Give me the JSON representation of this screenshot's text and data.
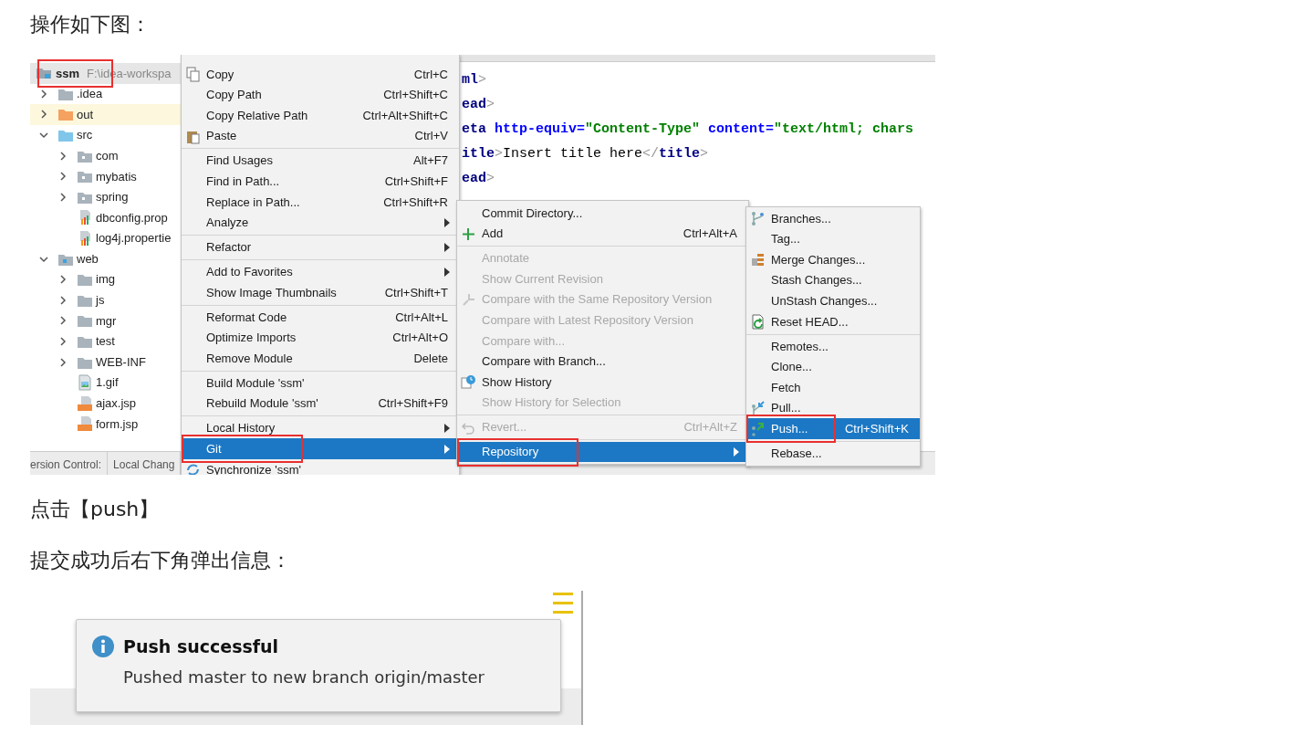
{
  "intro_text": "操作如下图：",
  "ide_screenshot": {
    "project_tree": {
      "root": {
        "label": "ssm",
        "path": "F:\\idea-workspa",
        "annotated": true
      },
      "items": [
        {
          "label": ".idea",
          "kind": "folder",
          "expanded": false
        },
        {
          "label": "out",
          "kind": "output_folder",
          "expanded": false
        },
        {
          "label": "src",
          "kind": "source_folder",
          "expanded": true,
          "children": [
            {
              "label": "com",
              "kind": "package",
              "expanded": false
            },
            {
              "label": "mybatis",
              "kind": "package",
              "expanded": false
            },
            {
              "label": "spring",
              "kind": "package",
              "expanded": false
            },
            {
              "label": "dbconfig.prop",
              "kind": "properties_file"
            },
            {
              "label": "log4j.propertie",
              "kind": "properties_file"
            }
          ]
        },
        {
          "label": "web",
          "kind": "web_folder",
          "expanded": true,
          "children": [
            {
              "label": "img",
              "kind": "folder",
              "expanded": false
            },
            {
              "label": "js",
              "kind": "folder",
              "expanded": false
            },
            {
              "label": "mgr",
              "kind": "folder",
              "expanded": false
            },
            {
              "label": "test",
              "kind": "folder",
              "expanded": false
            },
            {
              "label": "WEB-INF",
              "kind": "folder",
              "expanded": false
            },
            {
              "label": "1.gif",
              "kind": "image_file"
            },
            {
              "label": "ajax.jsp",
              "kind": "jsp_file"
            },
            {
              "label": "form.jsp",
              "kind": "jsp_file"
            }
          ]
        }
      ]
    },
    "code_lines": [
      [
        {
          "kind": "tag",
          "text": "ml"
        },
        {
          "kind": "bracket",
          "text": ">"
        }
      ],
      [
        {
          "kind": "tag",
          "text": "ead"
        },
        {
          "kind": "bracket",
          "text": ">"
        }
      ],
      [
        {
          "kind": "tag",
          "text": "eta"
        },
        {
          "kind": "attr",
          "text": " http-equiv="
        },
        {
          "kind": "string",
          "text": "\"Content-Type\""
        },
        {
          "kind": "attr",
          "text": " content="
        },
        {
          "kind": "string",
          "text": "\"text/html; chars"
        }
      ],
      [
        {
          "kind": "tag",
          "text": "itle"
        },
        {
          "kind": "bracket",
          "text": ">"
        },
        {
          "kind": "text",
          "text": "Insert title here"
        },
        {
          "kind": "bracket",
          "text": "</"
        },
        {
          "kind": "tag",
          "text": "title"
        },
        {
          "kind": "bracket",
          "text": ">"
        }
      ],
      [
        {
          "kind": "tag",
          "text": "ead"
        },
        {
          "kind": "bracket",
          "text": ">"
        }
      ]
    ],
    "bottom_tabs": [
      "ersion Control:",
      "Local Chang"
    ],
    "menus": [
      {
        "items": [
          {
            "kind": "item",
            "label": "Copy",
            "shortcut": "Ctrl+C",
            "selected": false
          },
          {
            "kind": "item",
            "label": "Copy Path",
            "shortcut": "Ctrl+Shift+C",
            "selected": false
          },
          {
            "kind": "item",
            "label": "Copy Relative Path",
            "shortcut": "Ctrl+Alt+Shift+C",
            "selected": false
          },
          {
            "kind": "item",
            "label": "Paste",
            "shortcut": "Ctrl+V",
            "selected": false
          },
          {
            "kind": "separator"
          },
          {
            "kind": "item",
            "label": "Find Usages",
            "shortcut": "Alt+F7",
            "selected": false
          },
          {
            "kind": "item",
            "label": "Find in Path...",
            "shortcut": "Ctrl+Shift+F",
            "selected": false
          },
          {
            "kind": "item",
            "label": "Replace in Path...",
            "shortcut": "Ctrl+Shift+R",
            "selected": false
          },
          {
            "kind": "item",
            "label": "Analyze",
            "submenu": true,
            "selected": false
          },
          {
            "kind": "separator"
          },
          {
            "kind": "item",
            "label": "Refactor",
            "submenu": true,
            "selected": false
          },
          {
            "kind": "separator"
          },
          {
            "kind": "item",
            "label": "Add to Favorites",
            "submenu": true,
            "selected": false
          },
          {
            "kind": "item",
            "label": "Show Image Thumbnails",
            "shortcut": "Ctrl+Shift+T",
            "selected": false
          },
          {
            "kind": "separator"
          },
          {
            "kind": "item",
            "label": "Reformat Code",
            "shortcut": "Ctrl+Alt+L",
            "selected": false
          },
          {
            "kind": "item",
            "label": "Optimize Imports",
            "shortcut": "Ctrl+Alt+O",
            "selected": false
          },
          {
            "kind": "item",
            "label": "Remove Module",
            "shortcut": "Delete",
            "selected": false
          },
          {
            "kind": "separator"
          },
          {
            "kind": "item",
            "label": "Build Module 'ssm'",
            "selected": false
          },
          {
            "kind": "item",
            "label": "Rebuild Module 'ssm'",
            "shortcut": "Ctrl+Shift+F9",
            "selected": false
          },
          {
            "kind": "separator"
          },
          {
            "kind": "item",
            "label": "Local History",
            "submenu": true,
            "selected": false
          },
          {
            "kind": "item",
            "label": "Git",
            "submenu": true,
            "selected": true,
            "annotated": true
          },
          {
            "kind": "item",
            "label": "Synchronize 'ssm'",
            "selected": false
          }
        ]
      },
      {
        "items": [
          {
            "kind": "item",
            "label": "Commit Directory...",
            "disabled": false,
            "selected": false
          },
          {
            "kind": "item",
            "label": "Add",
            "shortcut": "Ctrl+Alt+A",
            "disabled": false,
            "selected": false
          },
          {
            "kind": "separator"
          },
          {
            "kind": "item",
            "label": "Annotate",
            "disabled": true,
            "selected": false
          },
          {
            "kind": "item",
            "label": "Show Current Revision",
            "disabled": true,
            "selected": false
          },
          {
            "kind": "item",
            "label": "Compare with the Same Repository Version",
            "disabled": true,
            "selected": false
          },
          {
            "kind": "item",
            "label": "Compare with Latest Repository Version",
            "disabled": true,
            "selected": false
          },
          {
            "kind": "item",
            "label": "Compare with...",
            "disabled": true,
            "selected": false
          },
          {
            "kind": "item",
            "label": "Compare with Branch...",
            "disabled": false,
            "selected": false
          },
          {
            "kind": "item",
            "label": "Show History",
            "disabled": false,
            "selected": false
          },
          {
            "kind": "item",
            "label": "Show History for Selection",
            "disabled": true,
            "selected": false
          },
          {
            "kind": "separator"
          },
          {
            "kind": "item",
            "label": "Revert...",
            "shortcut": "Ctrl+Alt+Z",
            "disabled": true,
            "selected": false
          },
          {
            "kind": "separator"
          },
          {
            "kind": "item",
            "label": "Repository",
            "submenu": true,
            "disabled": false,
            "selected": true,
            "annotated": true
          }
        ]
      },
      {
        "items": [
          {
            "kind": "item",
            "label": "Branches...",
            "selected": false
          },
          {
            "kind": "item",
            "label": "Tag...",
            "selected": false
          },
          {
            "kind": "item",
            "label": "Merge Changes...",
            "selected": false
          },
          {
            "kind": "item",
            "label": "Stash Changes...",
            "selected": false
          },
          {
            "kind": "item",
            "label": "UnStash Changes...",
            "selected": false
          },
          {
            "kind": "item",
            "label": "Reset HEAD...",
            "selected": false
          },
          {
            "kind": "separator"
          },
          {
            "kind": "item",
            "label": "Remotes...",
            "selected": false
          },
          {
            "kind": "item",
            "label": "Clone...",
            "selected": false
          },
          {
            "kind": "item",
            "label": "Fetch",
            "selected": false
          },
          {
            "kind": "item",
            "label": "Pull...",
            "selected": false
          },
          {
            "kind": "item",
            "label": "Push...",
            "shortcut": "Ctrl+Shift+K",
            "selected": true,
            "annotated": true
          },
          {
            "kind": "separator"
          },
          {
            "kind": "item",
            "label": "Rebase...",
            "selected": false
          }
        ]
      }
    ]
  },
  "push_caption": "点击【push】",
  "result_caption": "提交成功后右下角弹出信息：",
  "notification": {
    "title": "Push successful",
    "message": "Pushed master to new branch origin/master"
  }
}
